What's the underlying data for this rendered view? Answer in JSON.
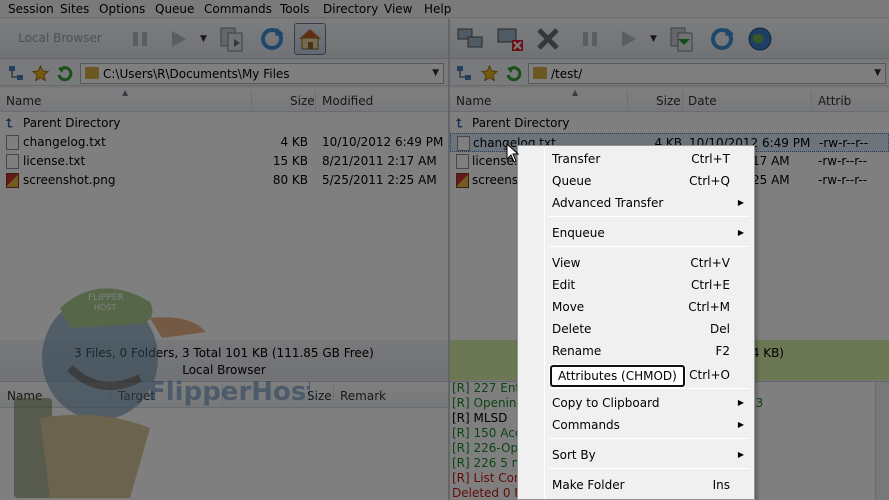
{
  "menubar": {
    "items": [
      "Session",
      "Sites",
      "Options",
      "Queue",
      "Commands",
      "Tools",
      "Directory",
      "View",
      "Help"
    ]
  },
  "toolbar_left": {
    "label": "Local Browser"
  },
  "left": {
    "path": "C:\\Users\\R\\Documents\\My Files",
    "columns": [
      "Name",
      "Size",
      "Modified"
    ],
    "parent_label": "Parent Directory",
    "files": [
      {
        "name": "changelog.txt",
        "size": "4 KB",
        "modified": "10/10/2012 6:49 PM",
        "icon": "text-file-icon"
      },
      {
        "name": "license.txt",
        "size": "15 KB",
        "modified": "8/21/2011 2:17 AM",
        "icon": "text-file-icon"
      },
      {
        "name": "screenshot.png",
        "size": "80 KB",
        "modified": "5/25/2011 2:25 AM",
        "icon": "image-file-icon"
      }
    ],
    "status_line1": "3 Files, 0 Folders, 3 Total 101 KB (111.85 GB Free)",
    "status_line2": "Local Browser"
  },
  "right": {
    "path": "/test/",
    "columns": [
      "Name",
      "Size",
      "Date",
      "Attrib"
    ],
    "parent_label": "Parent Directory",
    "files": [
      {
        "name": "changelog.txt",
        "size": "4 KB",
        "date": "10/10/2012 6:49 PM",
        "attrib": "-rw-r--r--"
      },
      {
        "name": "license.txt",
        "date": "17 AM",
        "attrib": "-rw-r--r--"
      },
      {
        "name": "screensh",
        "date": "25 AM",
        "attrib": "-rw-r--r--"
      }
    ],
    "status_line1": "(4 KB)"
  },
  "queue": {
    "columns": [
      "Name",
      "Target",
      "Size",
      "Remark"
    ]
  },
  "log": {
    "lines": [
      {
        "text": "[R] 227 Ente",
        "color": "green"
      },
      {
        "text": "[R] Opening",
        "color": "green"
      },
      {
        "text": "[R] MLSD",
        "color": "black"
      },
      {
        "text": "[R] 150 Acc",
        "color": "green"
      },
      {
        "text": "[R] 226-Opti",
        "color": "green"
      },
      {
        "text": "[R] 226 5 ma",
        "color": "green"
      },
      {
        "text": "[R] List Com",
        "color": "red"
      },
      {
        "text": "Deleted 0 Fil",
        "color": "red"
      }
    ],
    "trailing": "23"
  },
  "watermark": {
    "brand": "FlipperHost",
    "cap_text": "FLIPPER HOST"
  },
  "context_menu": {
    "items": [
      {
        "label": "Transfer",
        "key": "Ctrl+T"
      },
      {
        "label": "Queue",
        "key": "Ctrl+Q"
      },
      {
        "label": "Advanced Transfer",
        "submenu": true
      },
      {
        "sep": true
      },
      {
        "label": "Enqueue",
        "submenu": true
      },
      {
        "sep": true
      },
      {
        "label": "View",
        "key": "Ctrl+V"
      },
      {
        "label": "Edit",
        "key": "Ctrl+E"
      },
      {
        "label": "Move",
        "key": "Ctrl+M"
      },
      {
        "label": "Delete",
        "key": "Del"
      },
      {
        "label": "Rename",
        "key": "F2"
      },
      {
        "label": "Attributes (CHMOD)",
        "key": "Ctrl+O",
        "highlight": true
      },
      {
        "sep": true
      },
      {
        "label": "Copy to Clipboard",
        "submenu": true
      },
      {
        "label": "Commands",
        "submenu": true
      },
      {
        "sep": true
      },
      {
        "label": "Sort By",
        "submenu": true
      },
      {
        "sep": true
      },
      {
        "label": "Make Folder",
        "key": "Ins"
      }
    ]
  }
}
